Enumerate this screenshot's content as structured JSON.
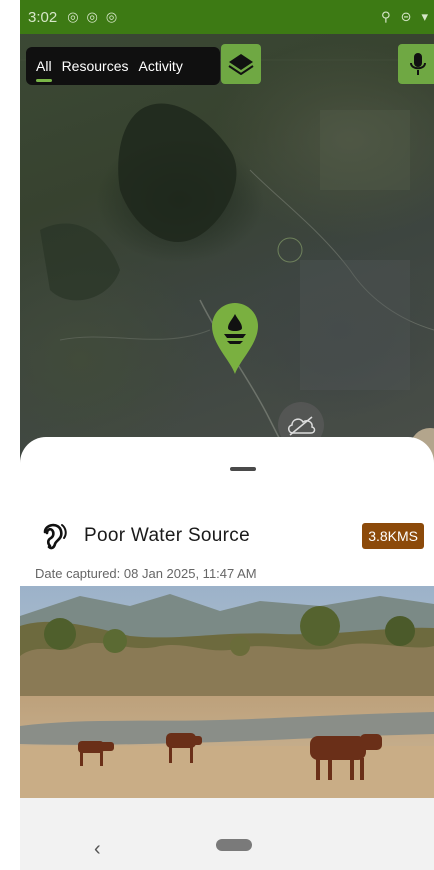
{
  "status_bar": {
    "time": "3:02"
  },
  "tabs": [
    {
      "label": "All",
      "active": true
    },
    {
      "label": "Resources",
      "active": false
    },
    {
      "label": "Activity",
      "active": false
    }
  ],
  "icons": {
    "layers": "layers-icon",
    "mic": "microphone-icon",
    "pin": "water-source-pin-icon",
    "cloud": "cloud-off-icon",
    "ear": "ear-icon"
  },
  "sheet": {
    "title": "Poor Water Source",
    "distance": "3.8KMS",
    "date_captured": "Date captured: 08 Jan 2025, 11:47 AM"
  },
  "nav": {
    "back": "‹"
  },
  "colors": {
    "accent": "#6fa843",
    "status_bar": "#3d7a14",
    "distance_badge": "#8c4a0a"
  }
}
